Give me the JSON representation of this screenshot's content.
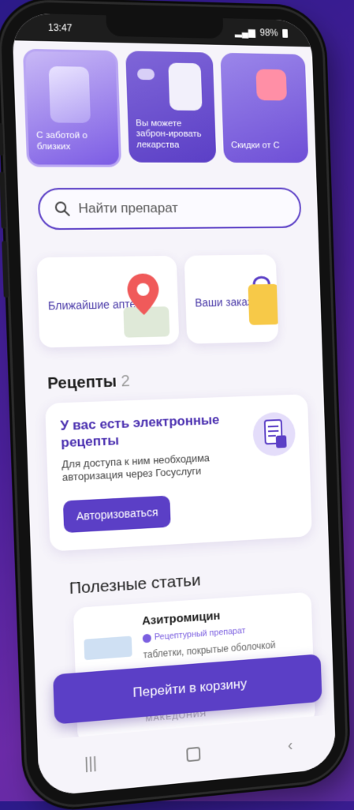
{
  "status_bar": {
    "time": "13:47",
    "battery": "98%"
  },
  "stories": [
    {
      "text": "С заботой о близких"
    },
    {
      "text": "Вы можете заброн-ировать лекарства"
    },
    {
      "text": "Скидки от С"
    }
  ],
  "search": {
    "placeholder": "Найти препарат"
  },
  "tiles": [
    {
      "label": "Ближайшие аптеки"
    },
    {
      "label": "Ваши заказы"
    }
  ],
  "prescriptions": {
    "title": "Рецепты",
    "count": "2",
    "card_title": "У вас есть электронные рецепты",
    "card_desc": "Для доступа к ним необходима авторизация через Госуслуги",
    "auth_button": "Авторизоваться"
  },
  "articles": {
    "title": "Полезные статьи",
    "item": {
      "name": "Азитромицин",
      "badge": "Рецептурный препарат",
      "desc": "таблетки, покрытые оболочкой",
      "maker": "МАКЕДОНИЯ"
    }
  },
  "cart_button": "Перейти в корзину",
  "colors": {
    "accent": "#5b3fc6",
    "accent_light": "#7b5fe0",
    "background": "#f6f4fa"
  }
}
